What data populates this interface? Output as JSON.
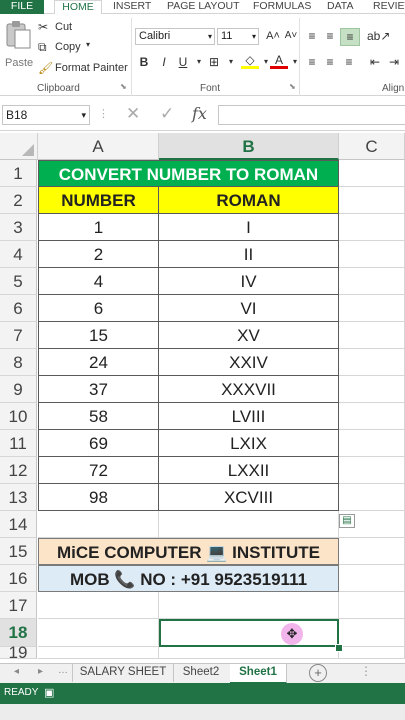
{
  "ribbon_tabs": [
    "FILE",
    "HOME",
    "INSERT",
    "PAGE LAYOUT",
    "FORMULAS",
    "DATA",
    "REVIEW"
  ],
  "clipboard": {
    "paste": "Paste",
    "cut": "Cut",
    "copy": "Copy",
    "format_painter": "Format Painter",
    "group_label": "Clipboard"
  },
  "font": {
    "name": "Calibri",
    "size": "11",
    "group_label": "Font"
  },
  "alignment": {
    "group_label": "Align"
  },
  "formula_bar": {
    "name_box": "B18",
    "fx": "fx",
    "formula": ""
  },
  "columns": [
    "A",
    "B",
    "C"
  ],
  "rows": [
    "1",
    "2",
    "3",
    "4",
    "5",
    "6",
    "7",
    "8",
    "9",
    "10",
    "11",
    "12",
    "13",
    "14",
    "15",
    "16",
    "17",
    "18",
    "19"
  ],
  "sheet": {
    "title": "CONVERT NUMBER TO ROMAN",
    "headers": [
      "NUMBER",
      "ROMAN"
    ],
    "data": [
      [
        "1",
        "I"
      ],
      [
        "2",
        "II"
      ],
      [
        "4",
        "IV"
      ],
      [
        "6",
        "VI"
      ],
      [
        "15",
        "XV"
      ],
      [
        "24",
        "XXIV"
      ],
      [
        "37",
        "XXXVII"
      ],
      [
        "58",
        "LVIII"
      ],
      [
        "69",
        "LXIX"
      ],
      [
        "72",
        "LXXII"
      ],
      [
        "98",
        "XCVIII"
      ]
    ],
    "banner1": "MiCE COMPUTER 💻 INSTITUTE",
    "banner2": "MOB 📞 NO : +91 9523519111"
  },
  "sheet_tabs": [
    "SALARY SHEET",
    "Sheet2",
    "Sheet1"
  ],
  "active_sheet": "Sheet1",
  "status": "READY",
  "colors": {
    "excel_green": "#217346",
    "title_fill": "#00B050",
    "header_fill": "#FFFF00",
    "banner1_fill": "#FCE4C8",
    "banner2_fill": "#DDEBF7"
  }
}
